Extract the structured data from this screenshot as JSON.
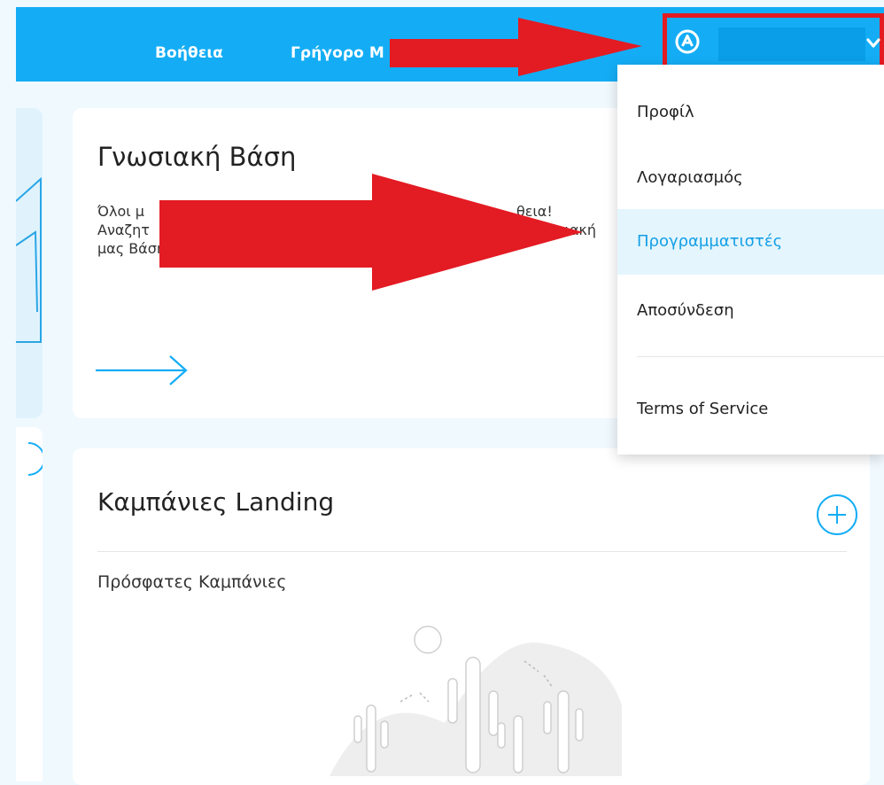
{
  "nav": {
    "help_label": "Βοήθεια",
    "quick_label": "Γρήγορο Μ"
  },
  "user_menu": {
    "avatar_icon": "account-circle-icon",
    "chevron_icon": "chevron-down-icon",
    "highlight_color": "#e31b23"
  },
  "knowledge_base": {
    "title": "Γνωσιακή Βάση",
    "line1_a": "Όλοι μ",
    "line1_b": "θεια!",
    "line2_a": "Αναζητ",
    "line2_b": "ωσιακή",
    "line3": "μας Βάση.",
    "arrow_icon": "arrow-right-icon"
  },
  "landing": {
    "title": "Καμπάνιες Landing",
    "recent_label": "Πρόσφατες Καμπάνιες",
    "add_icon": "plus-circle-icon",
    "empty_illustration": "desert-cactus-illustration"
  },
  "dropdown": {
    "items": [
      {
        "label": "Προφίλ"
      },
      {
        "label": "Λογαριασμός"
      },
      {
        "label": "Προγραμματιστές"
      },
      {
        "label": "Αποσύνδεση"
      },
      {
        "label": "Terms of Service"
      }
    ]
  },
  "annotations": {
    "arrow_color": "#e31b23"
  },
  "colors": {
    "accent": "#14adf5",
    "active_text": "#139fe6",
    "background": "#f0f9fe"
  }
}
